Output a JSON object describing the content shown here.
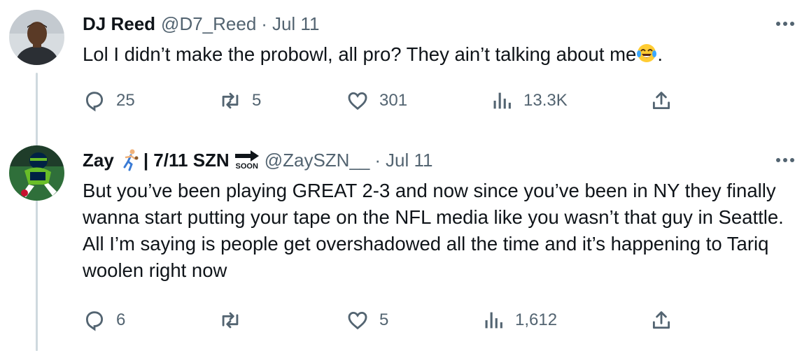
{
  "tweets": [
    {
      "author_name": "DJ Reed",
      "handle": "@D7_Reed",
      "separator": "·",
      "date": "Jul 11",
      "text": "Lol I didn’t make the probowl, all pro? They ain’t talking about me",
      "text_end": ".",
      "emoji": "face-with-tears-of-joy",
      "replies": "25",
      "retweets": "5",
      "likes": "301",
      "views": "13.3K"
    },
    {
      "author_name": "Zay",
      "name_suffix": "| 7/11 SZN",
      "soon_label": "SOON",
      "handle": "@ZaySZN__",
      "separator": "·",
      "date": "Jul 11",
      "text": "But you’ve been playing GREAT 2-3 and now since you’ve been in NY they finally wanna start putting your tape on the NFL media like you wasn’t that guy in Seattle. All I’m saying is people get overshadowed all the time and it’s happening to Tariq woolen right now",
      "replies": "6",
      "retweets": "",
      "likes": "5",
      "views": "1,612"
    }
  ],
  "colors": {
    "text": "#0f1419",
    "muted": "#536471",
    "thread_line": "#cfd9de",
    "seahawks_green": "#69be28",
    "seahawks_navy": "#002244"
  }
}
